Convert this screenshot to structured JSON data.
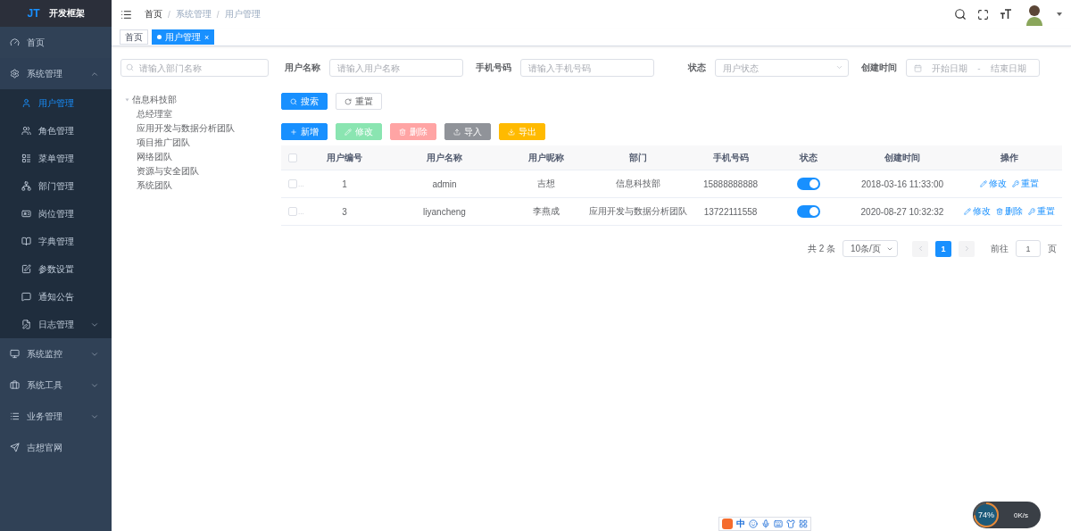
{
  "logo": {
    "mark": "JT",
    "title": "开发框架"
  },
  "sidebar": {
    "items": [
      {
        "label": "首页",
        "selected": false
      },
      {
        "label": "系统管理",
        "selected": false,
        "expanded": true,
        "children": [
          {
            "label": "用户管理",
            "selected": true
          },
          {
            "label": "角色管理",
            "selected": false
          },
          {
            "label": "菜单管理",
            "selected": false
          },
          {
            "label": "部门管理",
            "selected": false
          },
          {
            "label": "岗位管理",
            "selected": false
          },
          {
            "label": "字典管理",
            "selected": false
          },
          {
            "label": "参数设置",
            "selected": false
          },
          {
            "label": "通知公告",
            "selected": false
          },
          {
            "label": "日志管理",
            "selected": false,
            "expanded": false
          }
        ]
      },
      {
        "label": "系统监控",
        "selected": false,
        "expanded": false
      },
      {
        "label": "系统工具",
        "selected": false,
        "expanded": false
      },
      {
        "label": "业务管理",
        "selected": false,
        "expanded": false
      },
      {
        "label": "吉想官网",
        "selected": false
      }
    ]
  },
  "breadcrumb": [
    "首页",
    "系统管理",
    "用户管理"
  ],
  "breadcrumb_separator": "/",
  "tags": [
    {
      "label": "首页",
      "selected": false
    },
    {
      "label": "用户管理",
      "selected": true,
      "close": "×"
    }
  ],
  "dept_search": {
    "placeholder": "请输入部门名称"
  },
  "dept_tree": [
    {
      "label": "信息科技部",
      "expanded": true,
      "children": [
        {
          "label": "总经理室"
        },
        {
          "label": "应用开发与数据分析团队"
        },
        {
          "label": "项目推广团队"
        },
        {
          "label": "网络团队"
        },
        {
          "label": "资源与安全团队"
        },
        {
          "label": "系统团队"
        }
      ]
    }
  ],
  "filters": [
    {
      "kind": "input",
      "label": "用户名称",
      "placeholder": "请输入用户名称"
    },
    {
      "kind": "input",
      "label": "手机号码",
      "placeholder": "请输入手机号码"
    },
    {
      "kind": "select",
      "label": "状态",
      "placeholder": "用户状态"
    },
    {
      "kind": "daterange",
      "label": "创建时间",
      "start": {
        "placeholder": "开始日期"
      },
      "sep": "-",
      "end": {
        "placeholder": "结束日期"
      }
    }
  ],
  "search_buttons": [
    {
      "kind": "primary",
      "label": "搜索"
    },
    {
      "kind": "plain",
      "label": "重置"
    }
  ],
  "toolbar": [
    {
      "label": "新增",
      "color": "#1890ff"
    },
    {
      "label": "修改",
      "color": "#8ae5b1"
    },
    {
      "label": "删除",
      "color": "#ffa4a4"
    },
    {
      "label": "导入",
      "color": "#909399"
    },
    {
      "label": "导出",
      "color": "#ffba00"
    }
  ],
  "table": {
    "header_checked": false,
    "columns": [
      "用户编号",
      "用户名称",
      "用户昵称",
      "部门",
      "手机号码",
      "状态",
      "创建时间",
      "操作"
    ],
    "rows": [
      {
        "checked": false,
        "overflow": "...",
        "id": "1",
        "name": "admin",
        "nickname": "吉想",
        "dept": "信息科技部",
        "phone": "15888888888",
        "on": true,
        "created": "2018-03-16 11:33:00",
        "actions": [
          {
            "kind": "edit",
            "label": "修改"
          },
          {
            "kind": "reset",
            "label": "重置"
          }
        ]
      },
      {
        "checked": false,
        "overflow": "...",
        "id": "3",
        "name": "liyancheng",
        "nickname": "李燕成",
        "dept": "应用开发与数据分析团队",
        "phone": "13722111558",
        "on": true,
        "created": "2020-08-27 10:32:32",
        "actions": [
          {
            "kind": "edit",
            "label": "修改"
          },
          {
            "kind": "delete",
            "label": "删除"
          },
          {
            "kind": "reset",
            "label": "重置"
          }
        ]
      }
    ]
  },
  "pagination": {
    "total": "共 2 条",
    "page_size": "10条/页",
    "pages": [
      {
        "label": "1",
        "selected": true
      }
    ],
    "goto_label": "前往",
    "goto_value": "1",
    "goto_suffix": "页"
  },
  "ime_toolbar": {
    "mode": "中"
  },
  "net_widget": {
    "percent": "74%",
    "speed": "0K/s"
  }
}
